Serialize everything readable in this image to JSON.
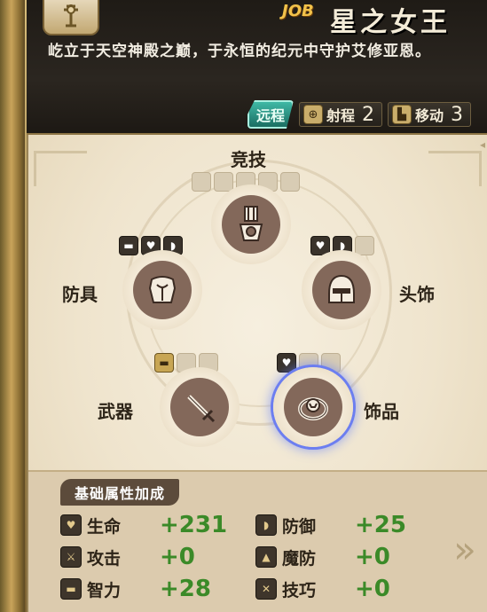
{
  "header": {
    "job_tag": "JOB",
    "job_name": "星之女王",
    "description": "屹立于天空神殿之巅，于永恒的纪元中守护艾修亚恩。",
    "range_type": "远程",
    "range_label": "射程",
    "range_value": "2",
    "move_label": "移动",
    "move_value": "3"
  },
  "slots": {
    "arena": {
      "label": "竞技"
    },
    "armor": {
      "label": "防具"
    },
    "head": {
      "label": "头饰"
    },
    "weapon": {
      "label": "武器"
    },
    "accessory": {
      "label": "饰品"
    }
  },
  "bonus": {
    "title": "基础属性加成",
    "rows": [
      {
        "left": {
          "label": "生命",
          "value": "+231",
          "icon": "heart-icon"
        },
        "right": {
          "label": "防御",
          "value": "+25",
          "icon": "shield-icon"
        }
      },
      {
        "left": {
          "label": "攻击",
          "value": "+0",
          "icon": "sword-icon"
        },
        "right": {
          "label": "魔防",
          "value": "+0",
          "icon": "magic-hat-icon"
        }
      },
      {
        "left": {
          "label": "智力",
          "value": "+28",
          "icon": "book-icon"
        },
        "right": {
          "label": "技巧",
          "value": "+0",
          "icon": "skill-icon"
        }
      }
    ]
  },
  "colors": {
    "bonus_value": "#3b8a28",
    "selected_glow": "#6c7ef0",
    "slot_fill": "#83685a"
  }
}
